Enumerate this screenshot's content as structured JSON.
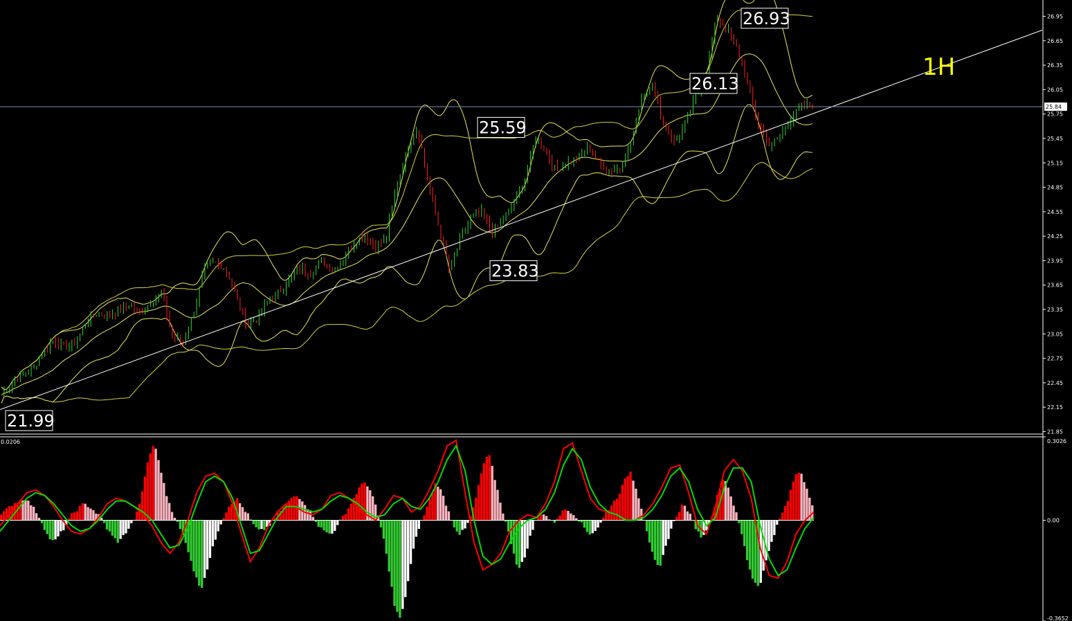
{
  "chart_data": [
    {
      "type": "candlestick",
      "timeframe_label": "1H",
      "y_tick_labels": [
        "26.95",
        "26.65",
        "26.35",
        "26.05",
        "25.75",
        "25.45",
        "25.15",
        "24.85",
        "24.55",
        "24.25",
        "23.95",
        "23.65",
        "23.35",
        "23.05",
        "22.75",
        "22.45",
        "22.15",
        "21.85"
      ],
      "ylim": [
        21.82,
        27.15
      ],
      "current_price": "25.84",
      "callouts": [
        {
          "text": "21.99",
          "value": 21.99
        },
        {
          "text": "25.59",
          "value": 25.59
        },
        {
          "text": "23.83",
          "value": 23.83
        },
        {
          "text": "26.13",
          "value": 26.13
        },
        {
          "text": "26.93",
          "value": 26.93
        }
      ],
      "trendline": {
        "from_value": 22.12,
        "to_value": 26.78
      },
      "overlays": [
        "Bollinger Bands",
        "Bollinger Bands"
      ],
      "price_path": [
        22.3,
        22.45,
        22.55,
        22.62,
        22.85,
        22.98,
        22.88,
        22.95,
        23.22,
        23.31,
        23.28,
        23.33,
        23.42,
        23.3,
        23.45,
        23.55,
        23.02,
        22.95,
        23.3,
        23.86,
        23.92,
        23.86,
        23.52,
        23.15,
        23.25,
        23.45,
        23.55,
        23.72,
        23.86,
        23.78,
        23.95,
        23.83,
        23.97,
        24.15,
        24.28,
        24.12,
        24.2,
        24.85,
        25.3,
        25.59,
        24.9,
        24.35,
        23.83,
        24.2,
        24.48,
        24.55,
        24.32,
        24.45,
        24.65,
        24.9,
        25.45,
        25.3,
        25.05,
        25.15,
        25.2,
        25.35,
        25.15,
        25.05,
        25.1,
        25.4,
        25.95,
        26.13,
        25.65,
        25.4,
        25.6,
        25.95,
        26.2,
        26.93,
        26.8,
        26.55,
        26.05,
        25.6,
        25.35,
        25.5,
        25.7,
        25.85,
        25.84
      ]
    },
    {
      "type": "bar",
      "indicator": "MACD",
      "y_tick_labels": [
        "0.3026",
        "0.00",
        "-0.3652"
      ],
      "left_label": "0.0206",
      "ylim": [
        -0.3652,
        0.3026
      ],
      "colors": {
        "rising_pos": "#ff0000",
        "falling_pos": "#ffb6c1",
        "falling_neg": "#32cd32",
        "rising_neg": "#ffffff",
        "signal": "#ff0000",
        "main": "#00dd00"
      },
      "histogram": [
        0.02,
        0.04,
        0.06,
        0.07,
        0.08,
        0.06,
        0.03,
        -0.01,
        -0.06,
        -0.08,
        -0.05,
        -0.02,
        0.02,
        0.04,
        0.06,
        0.05,
        0.03,
        0.01,
        -0.03,
        -0.06,
        -0.08,
        -0.05,
        -0.02,
        0.02,
        0.1,
        0.22,
        0.28,
        0.2,
        0.1,
        0.04,
        -0.01,
        -0.06,
        -0.12,
        -0.2,
        -0.25,
        -0.18,
        -0.1,
        -0.03,
        0.02,
        0.06,
        0.08,
        0.05,
        0.02,
        -0.02,
        -0.04,
        -0.03,
        -0.01,
        0.02,
        0.05,
        0.07,
        0.09,
        0.08,
        0.05,
        0.02,
        -0.02,
        -0.04,
        -0.05,
        -0.03,
        0.01,
        0.04,
        0.08,
        0.12,
        0.14,
        0.1,
        0.03,
        -0.06,
        -0.18,
        -0.32,
        -0.36,
        -0.25,
        -0.12,
        -0.03,
        0.02,
        0.08,
        0.14,
        0.1,
        0.04,
        -0.02,
        -0.05,
        -0.03,
        0.02,
        0.1,
        0.2,
        0.24,
        0.15,
        0.06,
        -0.02,
        -0.1,
        -0.18,
        -0.14,
        -0.06,
        0.0,
        0.03,
        0.01,
        -0.01,
        0.02,
        0.04,
        0.03,
        0.01,
        -0.02,
        -0.05,
        -0.04,
        -0.01,
        0.03,
        0.06,
        0.09,
        0.14,
        0.18,
        0.12,
        0.04,
        -0.05,
        -0.14,
        -0.18,
        -0.1,
        -0.03,
        0.02,
        0.06,
        0.03,
        -0.02,
        -0.06,
        -0.04,
        0.02,
        0.1,
        0.16,
        0.1,
        0.03,
        -0.05,
        -0.15,
        -0.22,
        -0.24,
        -0.16,
        -0.08,
        -0.02,
        0.03,
        0.08,
        0.16,
        0.18,
        0.12,
        0.06
      ],
      "signal": [
        -0.02,
        0.02,
        0.06,
        0.1,
        0.11,
        0.09,
        0.05,
        0.0,
        -0.04,
        -0.05,
        -0.03,
        0.01,
        0.06,
        0.08,
        0.07,
        0.05,
        0.02,
        -0.02,
        -0.08,
        -0.12,
        -0.08,
        0.0,
        0.1,
        0.16,
        0.17,
        0.14,
        0.06,
        -0.05,
        -0.15,
        -0.1,
        -0.02,
        0.03,
        0.06,
        0.05,
        0.03,
        0.02,
        0.04,
        0.09,
        0.1,
        0.08,
        0.05,
        0.02,
        0.0,
        0.04,
        0.09,
        0.08,
        0.03,
        0.05,
        0.11,
        0.18,
        0.27,
        0.29,
        0.1,
        -0.08,
        -0.18,
        -0.16,
        -0.12,
        -0.04,
        0.0,
        0.02,
        0.01,
        0.06,
        0.14,
        0.26,
        0.28,
        0.18,
        0.08,
        0.04,
        0.03,
        0.02,
        0.0,
        0.0,
        0.02,
        0.06,
        0.12,
        0.19,
        0.2,
        0.1,
        -0.02,
        -0.05,
        0.05,
        0.18,
        0.22,
        0.18,
        0.08,
        -0.1,
        -0.2,
        -0.21,
        -0.15,
        -0.05,
        0.0,
        0.03
      ],
      "main": [
        -0.04,
        0.0,
        0.04,
        0.08,
        0.1,
        0.09,
        0.06,
        0.02,
        -0.02,
        -0.04,
        -0.03,
        0.0,
        0.04,
        0.07,
        0.07,
        0.05,
        0.03,
        0.0,
        -0.05,
        -0.1,
        -0.09,
        -0.03,
        0.06,
        0.14,
        0.16,
        0.14,
        0.08,
        -0.02,
        -0.12,
        -0.11,
        -0.05,
        0.01,
        0.05,
        0.05,
        0.04,
        0.03,
        0.04,
        0.07,
        0.09,
        0.08,
        0.06,
        0.03,
        0.01,
        0.02,
        0.06,
        0.08,
        0.05,
        0.04,
        0.08,
        0.14,
        0.22,
        0.27,
        0.18,
        0.0,
        -0.13,
        -0.16,
        -0.14,
        -0.08,
        -0.03,
        0.0,
        0.01,
        0.04,
        0.1,
        0.2,
        0.26,
        0.22,
        0.12,
        0.06,
        0.03,
        0.02,
        0.0,
        0.0,
        0.01,
        0.04,
        0.09,
        0.16,
        0.19,
        0.14,
        0.04,
        -0.02,
        0.01,
        0.12,
        0.19,
        0.19,
        0.14,
        -0.02,
        -0.14,
        -0.2,
        -0.18,
        -0.1,
        -0.03,
        0.01
      ]
    }
  ]
}
